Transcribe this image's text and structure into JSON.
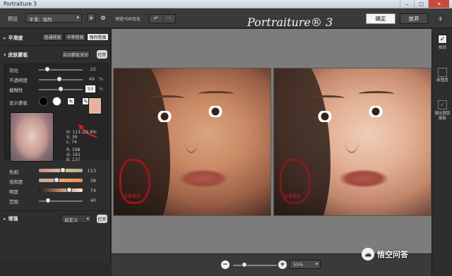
{
  "window": {
    "title": "Portraiture 3",
    "controls": [
      "–",
      "□",
      "✕"
    ]
  },
  "toolbar": {
    "preset_label": "预设",
    "preset_value": "平滑：强烈",
    "preview_label": "预览*OR仅化",
    "logo": "Portraiture® 3",
    "ok_label": "确定",
    "cancel_label": "放弃",
    "info_label": "i"
  },
  "smoothing": {
    "title": "平滑度",
    "levels": [
      "普通程度",
      "中等程度",
      "强烈程度"
    ],
    "active_level": "强烈程度"
  },
  "skin_mask": {
    "title": "皮肤蒙板",
    "auto_label": "自动蒙板关闭",
    "open_label": "打开",
    "feather_label": "羽化",
    "feather_value": "22",
    "opacity_label": "不透明度",
    "opacity_value": "49",
    "opacity_unit": "%",
    "fuzz_label": "模糊性",
    "fuzz_value": "53",
    "fuzz_unit": "%",
    "show_mask_label": "显示蒙板",
    "hsl_values": [
      "H: 113 /22.6%",
      "S: 39",
      "L: 74"
    ],
    "rgb_values": [
      "R: 198",
      "G: 161",
      "B: 137"
    ],
    "hue_label": "色相",
    "hue_value": "113",
    "sat_label": "饱和度",
    "sat_value": "38",
    "lum_label": "明度",
    "lum_value": "74",
    "range_label": "范围",
    "range_value": "40",
    "swatch_color": "#e6b49e"
  },
  "enhance": {
    "title": "增强",
    "custom_label": "自定义",
    "open_label": "打开"
  },
  "zoom": {
    "value": "55%"
  },
  "right_panel": {
    "same_label": "相同",
    "new_layer_label": "新图层",
    "output_label": "输出图层蒙板"
  },
  "stamp_text": "肖像摄影",
  "watermark": "悟空问答"
}
